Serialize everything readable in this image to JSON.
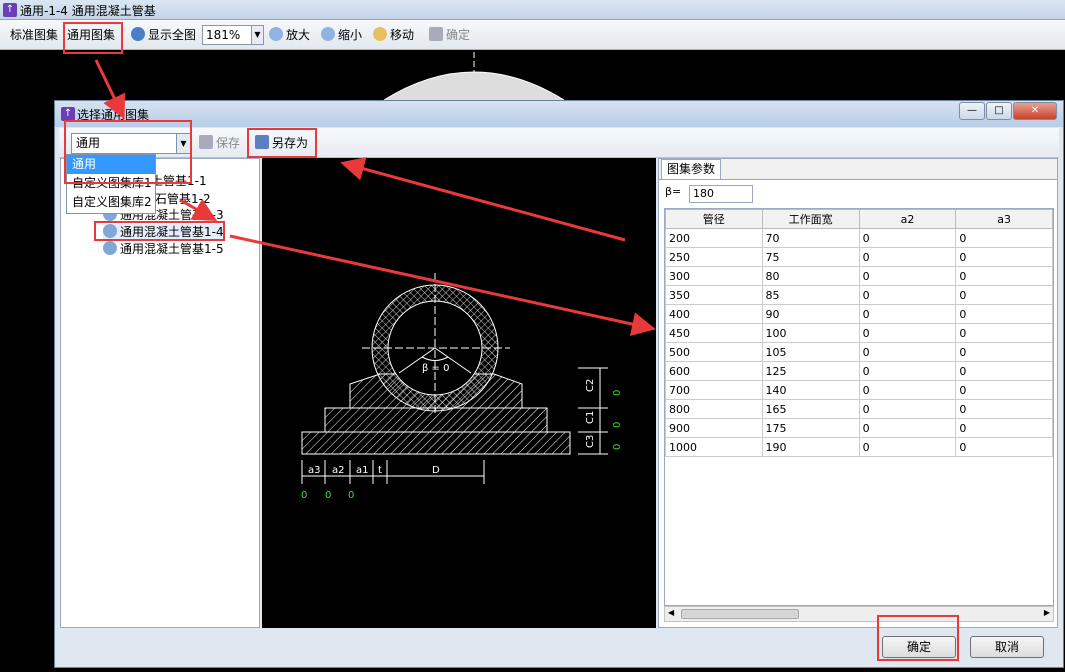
{
  "window": {
    "title": "通用-1-4 通用混凝土管基"
  },
  "toolbar": {
    "standard_atlas": "标准图集",
    "general_atlas": "通用图集",
    "show_all": "显示全图",
    "zoom_value": "181%",
    "zoom_in": "放大",
    "zoom_out": "缩小",
    "move": "移动",
    "confirm": "确定"
  },
  "dialog": {
    "title": "选择通用图集",
    "combo_value": "通用",
    "save": "保存",
    "save_as": "另存为",
    "dropdown_options": [
      "通用",
      "自定义图集库1",
      "自定义图集库2"
    ],
    "tree_items": [
      "通用混凝土管基1-1",
      "石管基1-2",
      "通用混凝土管基1-3",
      "通用混凝土管基1-4",
      "通用混凝土管基1-5"
    ],
    "drawing": {
      "beta_label": "β = 0",
      "dims_bottom": [
        "a3",
        "a2",
        "a1",
        "t",
        "D"
      ],
      "dims_bottom_values": [
        "0",
        "0",
        "0"
      ],
      "dims_side": [
        "C2",
        "C1",
        "C3"
      ],
      "dims_side_values": [
        "0",
        "0",
        "0"
      ]
    },
    "params": {
      "tab": "图集参数",
      "beta_label": "β=",
      "beta_value": "180",
      "columns": [
        "管径",
        "工作面宽",
        "a2",
        "a3"
      ],
      "rows": [
        [
          "200",
          "70",
          "0",
          "0"
        ],
        [
          "250",
          "75",
          "0",
          "0"
        ],
        [
          "300",
          "80",
          "0",
          "0"
        ],
        [
          "350",
          "85",
          "0",
          "0"
        ],
        [
          "400",
          "90",
          "0",
          "0"
        ],
        [
          "450",
          "100",
          "0",
          "0"
        ],
        [
          "500",
          "105",
          "0",
          "0"
        ],
        [
          "600",
          "125",
          "0",
          "0"
        ],
        [
          "700",
          "140",
          "0",
          "0"
        ],
        [
          "800",
          "165",
          "0",
          "0"
        ],
        [
          "900",
          "175",
          "0",
          "0"
        ],
        [
          "1000",
          "190",
          "0",
          "0"
        ]
      ]
    },
    "ok": "确定",
    "cancel": "取消"
  }
}
